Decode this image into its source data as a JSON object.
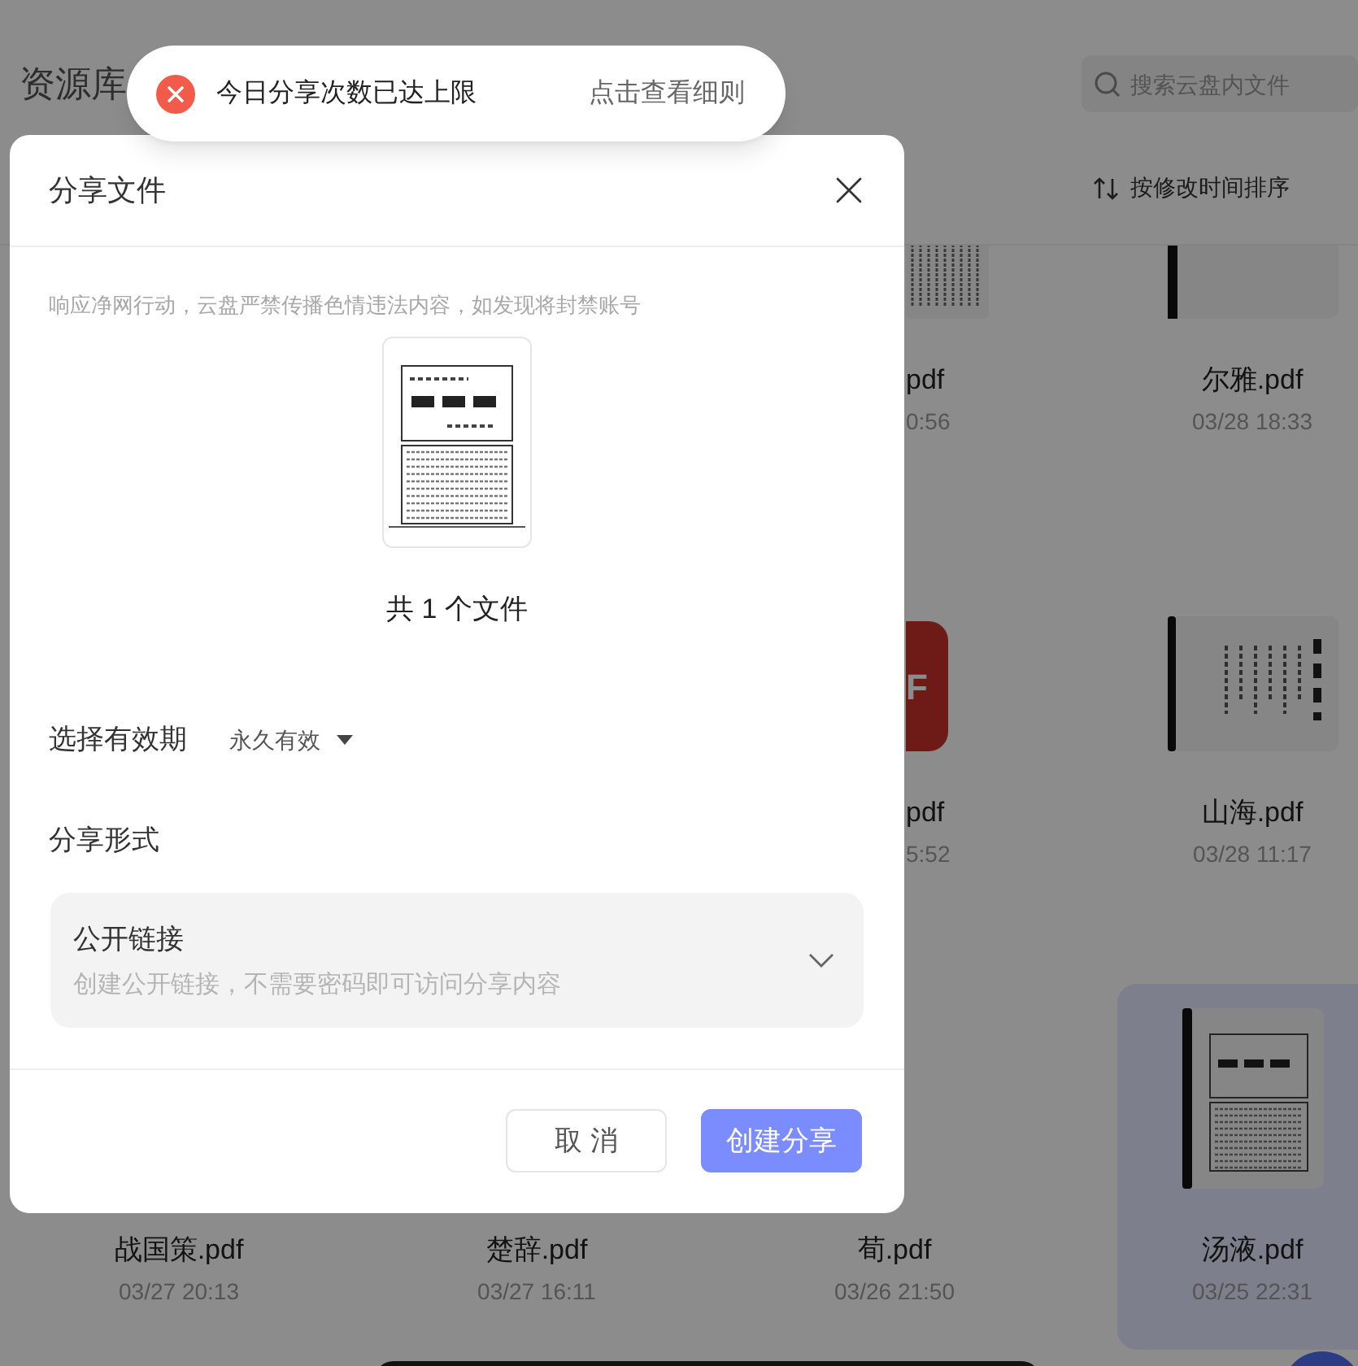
{
  "page": {
    "title": "资源库",
    "search": {
      "placeholder": "搜索云盘内文件"
    },
    "sort": {
      "label": "按修改时间排序"
    },
    "rows": [
      [
        null,
        null,
        {
          "kind": "scan",
          "name": "pdf",
          "date": "0:56",
          "cut": true,
          "selected": false
        },
        {
          "kind": "book",
          "name": "尔雅.pdf",
          "date": "03/28 18:33",
          "cut": false,
          "selected": false
        }
      ],
      [
        null,
        null,
        {
          "kind": "pdf",
          "label": "F",
          "name": "pdf",
          "date": "5:52",
          "cut": true,
          "selected": false
        },
        {
          "kind": "calligraphy",
          "name": "山海.pdf",
          "date": "03/28 11:17",
          "cut": false,
          "selected": false
        }
      ],
      [
        {
          "name": "战国策.pdf",
          "date": "03/27 20:13",
          "cut": false,
          "selected": false
        },
        {
          "name": "楚辞.pdf",
          "date": "03/27 16:11",
          "cut": false,
          "selected": false
        },
        {
          "name": "荀.pdf",
          "date": "03/26 21:50",
          "cut": false,
          "selected": false
        },
        {
          "kind": "book-scan",
          "name": "汤液.pdf",
          "date": "03/25 22:31",
          "cut": false,
          "selected": true
        }
      ]
    ]
  },
  "dialog": {
    "title": "分享文件",
    "notice": "响应净网行动，云盘严禁传播色情违法内容，如发现将封禁账号",
    "file_count": "共 1 个文件",
    "expiry": {
      "label": "选择有效期",
      "value": "永久有效"
    },
    "share_mode": {
      "label": "分享形式",
      "title": "公开链接",
      "description": "创建公开链接，不需要密码即可访问分享内容"
    },
    "buttons": [
      {
        "label": "取 消",
        "kind": "secondary"
      },
      {
        "label": "创建分享",
        "kind": "primary"
      }
    ]
  },
  "toast": {
    "kind": "error",
    "message": "今日分享次数已达上限",
    "link": "点击查看细则"
  }
}
